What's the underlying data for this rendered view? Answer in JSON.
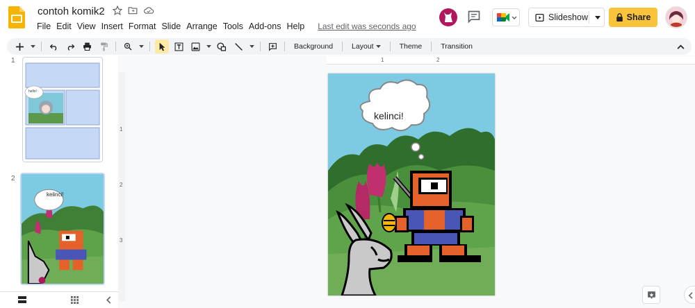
{
  "app": {
    "doc_title": "contoh komik2",
    "last_edit": "Last edit was seconds ago"
  },
  "menu": [
    "File",
    "Edit",
    "View",
    "Insert",
    "Format",
    "Slide",
    "Arrange",
    "Tools",
    "Add-ons",
    "Help"
  ],
  "header": {
    "slideshow_label": "Slideshow",
    "share_label": "Share"
  },
  "toolbar": {
    "background_label": "Background",
    "layout_label": "Layout",
    "theme_label": "Theme",
    "transition_label": "Transition"
  },
  "rulers": {
    "top": [
      "1",
      "2"
    ],
    "left": [
      "1",
      "2",
      "3"
    ]
  },
  "slides": [
    {
      "number": "1",
      "bubble_text": "hello!"
    },
    {
      "number": "2",
      "bubble_text": "kelinci!"
    }
  ],
  "main_slide": {
    "bubble_text": "kelinci!"
  },
  "icons": {
    "logo": "slides-logo-icon",
    "star": "star-icon",
    "move": "move-to-folder-icon",
    "cloud": "cloud-status-icon",
    "comment": "comment-icon",
    "meet": "meet-icon",
    "present": "present-icon",
    "lock": "lock-icon"
  },
  "colors": {
    "share_yellow": "#f9c33b",
    "slides_yellow": "#f4b400",
    "selection_blue": "#c2d7f7"
  }
}
